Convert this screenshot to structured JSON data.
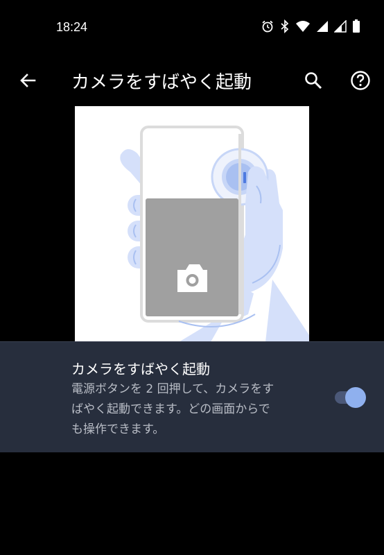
{
  "status_bar": {
    "time": "18:24",
    "icons": [
      "alarm-icon",
      "bluetooth-icon",
      "wifi-icon",
      "signal-icon",
      "signal-icon",
      "battery-icon"
    ]
  },
  "app_bar": {
    "title": "カメラをすばやく起動",
    "back_icon": "back-arrow-icon",
    "search_icon": "search-icon",
    "help_icon": "help-icon"
  },
  "illustration": {
    "icon": "camera-icon",
    "colors": {
      "hand": "#d5e0fa",
      "hand_line": "#a9c0f1",
      "phone_frame": "#dcdcdc",
      "screen": "#a0a0a0",
      "button_accent": "#4e7ae0"
    }
  },
  "setting": {
    "title": "カメラをすばやく起動",
    "description_lines": [
      "電源ボタンを 2 回押して、カメラをす",
      "ばやく起動できます。どの画面からで",
      "も操作できます。"
    ],
    "toggle_on": true
  },
  "colors": {
    "background": "#000000",
    "card": "#272e3d",
    "toggle_thumb": "#8fb0ee",
    "toggle_track": "#4b5878"
  }
}
